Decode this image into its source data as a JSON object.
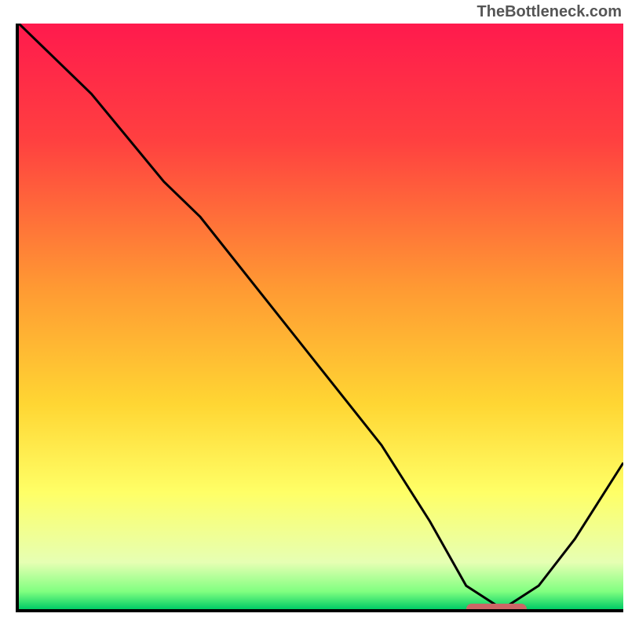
{
  "watermark": "TheBottleneck.com",
  "chart_data": {
    "type": "line",
    "title": "",
    "xlabel": "",
    "ylabel": "",
    "xlim": [
      0,
      100
    ],
    "ylim": [
      0,
      100
    ],
    "series": [
      {
        "name": "bottleneck-curve",
        "x": [
          0,
          12,
          24,
          30,
          40,
          50,
          60,
          68,
          74,
          80,
          86,
          92,
          100
        ],
        "y": [
          100,
          88,
          73,
          67,
          54,
          41,
          28,
          15,
          4,
          0,
          4,
          12,
          25
        ]
      }
    ],
    "marker": {
      "name": "optimal-range",
      "x_start": 74,
      "x_end": 84,
      "color": "#cc6666"
    },
    "gradient_stops": [
      {
        "offset": 0,
        "color": "#ff1a4d"
      },
      {
        "offset": 20,
        "color": "#ff4040"
      },
      {
        "offset": 45,
        "color": "#ff9933"
      },
      {
        "offset": 65,
        "color": "#ffd633"
      },
      {
        "offset": 80,
        "color": "#ffff66"
      },
      {
        "offset": 92,
        "color": "#e6ffb3"
      },
      {
        "offset": 97,
        "color": "#80ff80"
      },
      {
        "offset": 100,
        "color": "#00cc66"
      }
    ]
  }
}
